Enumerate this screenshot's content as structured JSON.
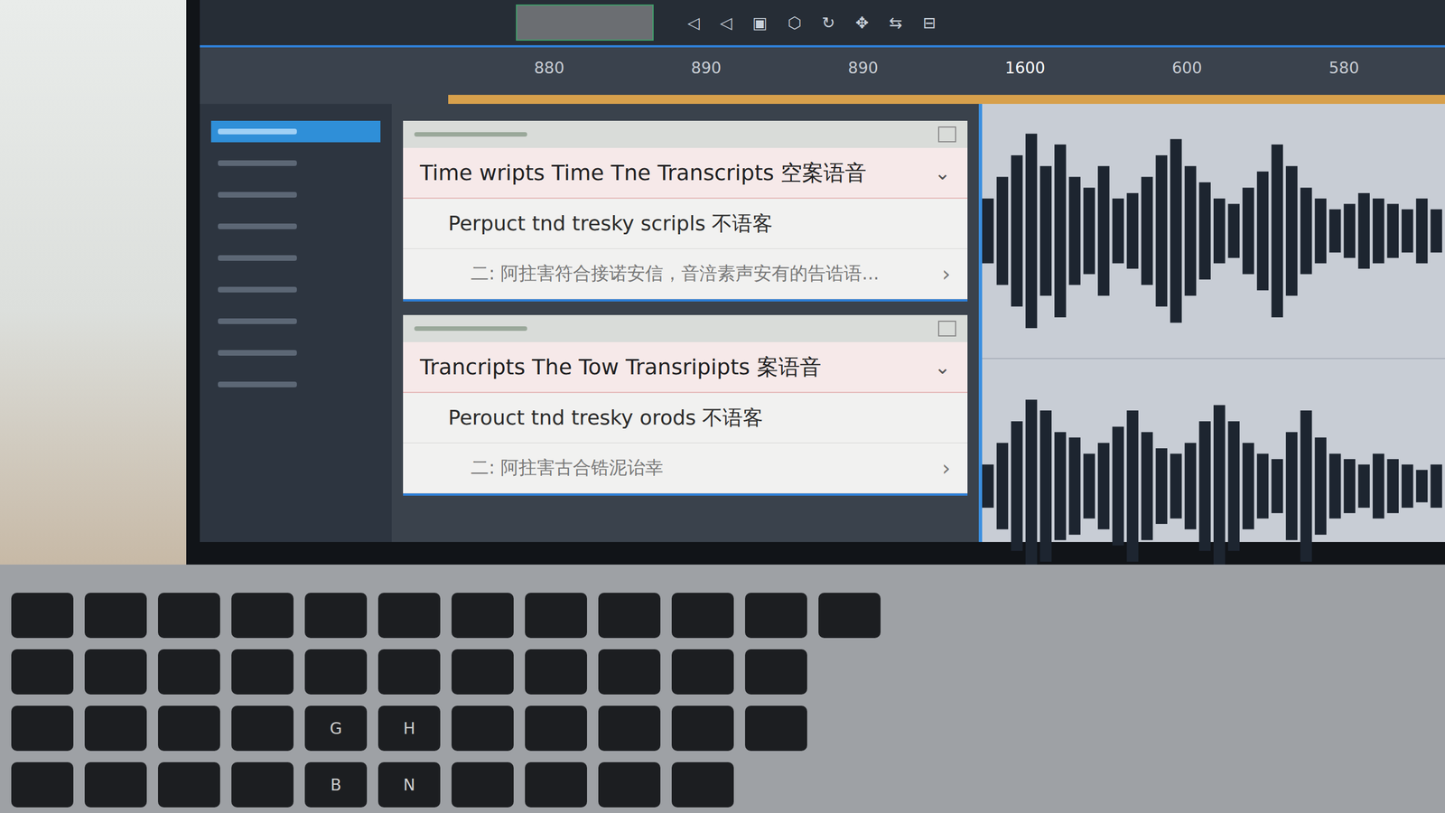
{
  "toolbar": {
    "icons": [
      "◁",
      "◁",
      "▣",
      "⬡",
      "↻",
      "✥",
      "⇆",
      "⊟"
    ]
  },
  "sidebar": {
    "items": [
      {
        "selected": true
      },
      {
        "selected": false
      },
      {
        "selected": false
      },
      {
        "selected": false
      },
      {
        "selected": false
      },
      {
        "selected": false
      },
      {
        "selected": false
      },
      {
        "selected": false
      },
      {
        "selected": false
      }
    ]
  },
  "ruler": {
    "ticks": [
      {
        "label": "880",
        "current": false
      },
      {
        "label": "890",
        "current": false
      },
      {
        "label": "890",
        "current": false
      },
      {
        "label": "1600",
        "current": true
      },
      {
        "label": "600",
        "current": false
      },
      {
        "label": "580",
        "current": false
      }
    ]
  },
  "transcripts": [
    {
      "title": "Time wripts Time Tne Transcripts 空案语音",
      "line": "Perpuct tnd tresky scripls 不语客",
      "detail": "二: 阿拄害符合接诺安信，音涪素声安有的告诰语...",
      "expand": "⌄",
      "more": "›"
    },
    {
      "title": "Trancripts The Tow Transripipts 案语音",
      "line": "Perouct tnd tresky orods 不语客",
      "detail": "二: 阿拄害古合锆泥诒幸",
      "expand": "⌄",
      "more": "›"
    }
  ],
  "waveforms": [
    {
      "samples": [
        0.3,
        0.5,
        0.7,
        0.9,
        0.6,
        0.8,
        0.5,
        0.4,
        0.6,
        0.3,
        0.35,
        0.5,
        0.7,
        0.85,
        0.6,
        0.45,
        0.3,
        0.25,
        0.4,
        0.55,
        0.8,
        0.6,
        0.4,
        0.3,
        0.2,
        0.25,
        0.35,
        0.3,
        0.25,
        0.2,
        0.3,
        0.2
      ]
    },
    {
      "samples": [
        0.2,
        0.4,
        0.6,
        0.8,
        0.7,
        0.5,
        0.45,
        0.3,
        0.4,
        0.55,
        0.7,
        0.5,
        0.35,
        0.3,
        0.4,
        0.6,
        0.75,
        0.6,
        0.4,
        0.3,
        0.25,
        0.5,
        0.7,
        0.45,
        0.3,
        0.25,
        0.2,
        0.3,
        0.25,
        0.2,
        0.15,
        0.2
      ]
    }
  ],
  "keyboard": {
    "rows": [
      [
        "",
        "",
        "",
        "",
        "",
        "",
        "",
        "",
        "",
        "",
        "",
        ""
      ],
      [
        "",
        "",
        "",
        "",
        "",
        "",
        "",
        "",
        "",
        "",
        ""
      ],
      [
        "",
        "",
        "",
        "",
        "G",
        "H",
        "",
        "",
        "",
        "",
        ""
      ],
      [
        "",
        "",
        "",
        "",
        "B",
        "N",
        "",
        "",
        "",
        ""
      ]
    ]
  }
}
